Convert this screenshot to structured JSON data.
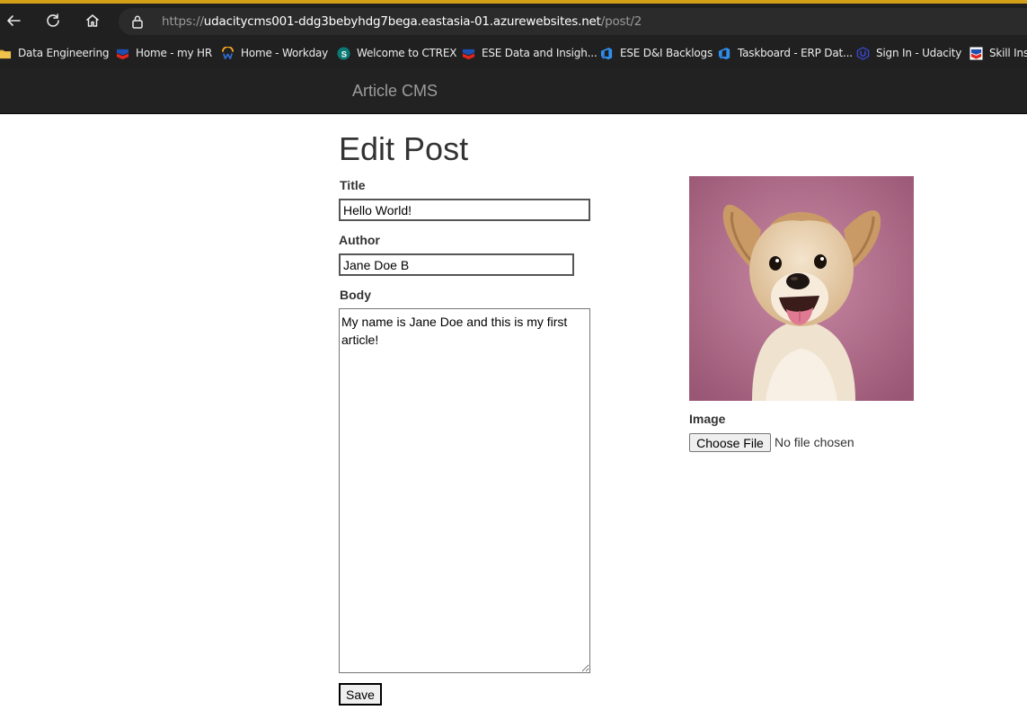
{
  "browser": {
    "url_scheme": "https://",
    "url_host": "udacitycms001-ddg3bebyhdg7bega.eastasia-01.azurewebsites.net",
    "url_path": "/post/2",
    "accent_color": "#d4a017",
    "icons": [
      "back-icon",
      "reload-icon",
      "home-icon",
      "lock-icon"
    ]
  },
  "bookmarks": [
    {
      "label": "Data Engineering",
      "icon": "folder-icon"
    },
    {
      "label": "Home - my HR",
      "icon": "chevron-brand-icon"
    },
    {
      "label": "Home - Workday",
      "icon": "workday-icon"
    },
    {
      "label": "Welcome to CTREX",
      "icon": "sharepoint-icon"
    },
    {
      "label": "ESE Data and Insigh...",
      "icon": "chevron-brand-icon"
    },
    {
      "label": "ESE D&I Backlogs",
      "icon": "azure-devops-icon"
    },
    {
      "label": "Taskboard - ERP Dat...",
      "icon": "azure-devops-icon"
    },
    {
      "label": "Sign In - Udacity",
      "icon": "udacity-icon"
    },
    {
      "label": "Skill Insi",
      "icon": "chevron-brand-icon"
    }
  ],
  "navbar": {
    "brand": "Article CMS"
  },
  "form": {
    "heading": "Edit Post",
    "title_label": "Title",
    "title_value": "Hello World!",
    "author_label": "Author",
    "author_value": "Jane Doe B",
    "body_label": "Body",
    "body_value": "My name is Jane Doe and this is my first article!",
    "save_label": "Save",
    "image_label": "Image",
    "choose_file_label": "Choose File",
    "no_file_text": "No file chosen"
  }
}
